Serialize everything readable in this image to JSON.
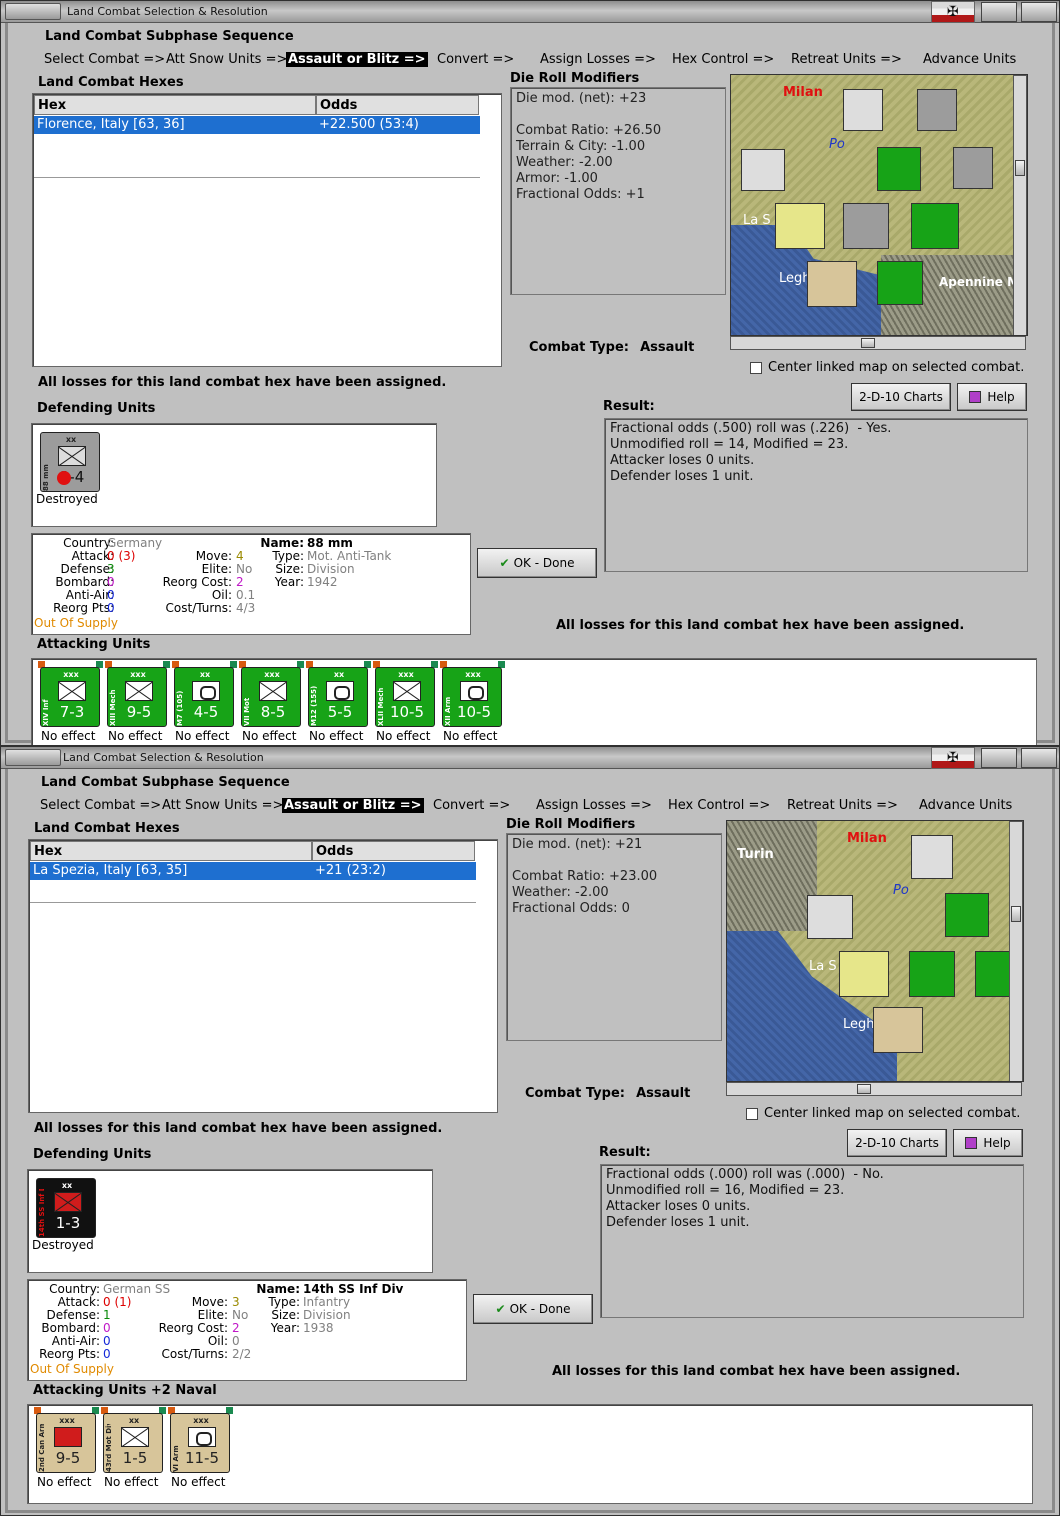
{
  "windows": [
    {
      "title": "Land Combat Selection & Resolution",
      "sequence_heading": "Land Combat Subphase Sequence",
      "sequence": [
        "Select Combat =>",
        "Att Snow Units =>",
        "Assault or Blitz =>",
        "Convert =>",
        "Assign Losses =>",
        "Hex Control =>",
        "Retreat Units =>",
        "Advance Units"
      ],
      "active_step": "Assault or Blitz =>",
      "hexes_heading": "Land Combat Hexes",
      "col_hex": "Hex",
      "col_odds": "Odds",
      "selected_hex": "Florence, Italy [63, 36]",
      "selected_odds": "+22.500 (53:4)",
      "modifiers_heading": "Die Roll Modifiers",
      "modifiers": [
        "Die mod. (net): +23",
        "",
        "Combat Ratio: +26.50",
        "Terrain & City: -1.00",
        "Weather: -2.00",
        "Armor: -1.00",
        "Fractional Odds: +1"
      ],
      "combat_type_label": "Combat Type:",
      "combat_type": "Assault",
      "center_map_label": "Center linked map on selected combat.",
      "losses_msg": "All losses for this land combat hex have been assigned.",
      "defending_heading": "Defending Units",
      "defenders": [
        {
          "name": "88 mm",
          "size": "xx",
          "value": "3-4",
          "status": "Destroyed",
          "color": "gray"
        }
      ],
      "charts_button": "2-D-10 Charts",
      "help_button": "Help",
      "result_heading": "Result:",
      "result_lines": [
        "Fractional odds (.500) roll was (.226)  - Yes.",
        "Unmodified roll = 14, Modified = 23.",
        "Attacker loses 0 units.",
        "Defender loses 1 unit."
      ],
      "ok_button": "OK - Done",
      "unit_info": {
        "country_label": "Country:",
        "country": "Germany",
        "attack_label": "Attack:",
        "attack": "0",
        "attack_extra": "(3)",
        "defense_label": "Defense:",
        "defense": "3",
        "bombard_label": "Bombard:",
        "bombard": "0",
        "antiair_label": "Anti-Air:",
        "antiair": "0",
        "reorg_pts_label": "Reorg Pts:",
        "reorg_pts": "0",
        "supply": "Out Of Supply",
        "move_label": "Move:",
        "move": "4",
        "elite_label": "Elite:",
        "elite": "No",
        "reorg_cost_label": "Reorg Cost:",
        "reorg_cost": "2",
        "oil_label": "Oil:",
        "oil": "0.1",
        "cost_turns_label": "Cost/Turns:",
        "cost_turns": "4/3",
        "name_label": "Name:",
        "name": "88 mm",
        "type_label": "Type:",
        "type": "Mot. Anti-Tank",
        "size_label": "Size:",
        "size": "Division",
        "year_label": "Year:",
        "year": "1942"
      },
      "attacking_heading": "Attacking Units",
      "attackers": [
        {
          "name": "XIV Inf",
          "size": "xxx",
          "value": "7-3",
          "status": "No effect",
          "color": "green",
          "sym": "x"
        },
        {
          "name": "XIII Mech",
          "size": "xxx",
          "value": "9-5",
          "status": "No effect",
          "color": "green",
          "sym": "x"
        },
        {
          "name": "M7 (105)",
          "size": "xx",
          "value": "4-5",
          "status": "No effect",
          "color": "green",
          "sym": "o"
        },
        {
          "name": "VII Mot",
          "size": "xxx",
          "value": "8-5",
          "status": "No effect",
          "color": "green",
          "sym": "x"
        },
        {
          "name": "M12 (155)",
          "size": "xx",
          "value": "5-5",
          "status": "No effect",
          "color": "green",
          "sym": "o"
        },
        {
          "name": "XLII Mech",
          "size": "xxx",
          "value": "10-5",
          "status": "No effect",
          "color": "green",
          "sym": "x"
        },
        {
          "name": "XII Arm",
          "size": "xxx",
          "value": "10-5",
          "status": "No effect",
          "color": "green",
          "sym": "o"
        }
      ],
      "map": {
        "city1": "Milan",
        "city2": "La S",
        "city3": "Legh",
        "region": "Apennine M",
        "river": "Po"
      }
    },
    {
      "title": "Land Combat Selection & Resolution",
      "sequence_heading": "Land Combat Subphase Sequence",
      "sequence": [
        "Select Combat =>",
        "Att Snow Units =>",
        "Assault or Blitz =>",
        "Convert =>",
        "Assign Losses =>",
        "Hex Control =>",
        "Retreat Units =>",
        "Advance Units"
      ],
      "active_step": "Assault or Blitz =>",
      "hexes_heading": "Land Combat Hexes",
      "col_hex": "Hex",
      "col_odds": "Odds",
      "selected_hex": "La Spezia, Italy [63, 35]",
      "selected_odds": "+21 (23:2)",
      "modifiers_heading": "Die Roll Modifiers",
      "modifiers": [
        "Die mod. (net): +21",
        "",
        "Combat Ratio: +23.00",
        "Weather: -2.00",
        "Fractional Odds: 0"
      ],
      "combat_type_label": "Combat Type:",
      "combat_type": "Assault",
      "center_map_label": "Center linked map on selected combat.",
      "losses_msg": "All losses for this land combat hex have been assigned.",
      "defending_heading": "Defending Units",
      "defenders": [
        {
          "name": "14th SS Inf D.",
          "size": "xx",
          "value": "1-3",
          "status": "Destroyed",
          "color": "black"
        }
      ],
      "charts_button": "2-D-10 Charts",
      "help_button": "Help",
      "result_heading": "Result:",
      "result_lines": [
        "Fractional odds (.000) roll was (.000)  - No.",
        "Unmodified roll = 16, Modified = 23.",
        "Attacker loses 0 units.",
        "Defender loses 1 unit."
      ],
      "ok_button": "OK - Done",
      "unit_info": {
        "country_label": "Country:",
        "country": "German SS",
        "attack_label": "Attack:",
        "attack": "0",
        "attack_extra": "(1)",
        "defense_label": "Defense:",
        "defense": "1",
        "bombard_label": "Bombard:",
        "bombard": "0",
        "antiair_label": "Anti-Air:",
        "antiair": "0",
        "reorg_pts_label": "Reorg Pts:",
        "reorg_pts": "0",
        "supply": "Out Of Supply",
        "move_label": "Move:",
        "move": "3",
        "elite_label": "Elite:",
        "elite": "No",
        "reorg_cost_label": "Reorg Cost:",
        "reorg_cost": "2",
        "oil_label": "Oil:",
        "oil": "0",
        "cost_turns_label": "Cost/Turns:",
        "cost_turns": "2/2",
        "name_label": "Name:",
        "name": "14th SS Inf Div",
        "type_label": "Type:",
        "type": "Infantry",
        "size_label": "Size:",
        "size": "Division",
        "year_label": "Year:",
        "year": "1938"
      },
      "attacking_heading": "Attacking Units +2 Naval",
      "attackers": [
        {
          "name": "2nd Can Arm",
          "size": "xxx",
          "value": "9-5",
          "status": "No effect",
          "color": "tan",
          "sym": "red"
        },
        {
          "name": "43rd Mot Div",
          "size": "xx",
          "value": "1-5",
          "status": "No effect",
          "color": "tan",
          "sym": "x"
        },
        {
          "name": "VI Arm",
          "size": "xxx",
          "value": "11-5",
          "status": "No effect",
          "color": "tan",
          "sym": "o"
        }
      ],
      "map": {
        "city1": "Milan",
        "city2": "La S",
        "city3": "Legh",
        "city4": "Turin",
        "river": "Po"
      }
    }
  ]
}
